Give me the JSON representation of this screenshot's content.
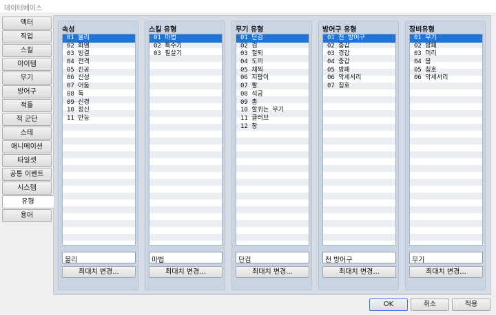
{
  "window": {
    "title": "데이터베이스"
  },
  "sidebar": {
    "items": [
      {
        "label": "액터"
      },
      {
        "label": "직업"
      },
      {
        "label": "스킬"
      },
      {
        "label": "아이템"
      },
      {
        "label": "무기"
      },
      {
        "label": "방어구"
      },
      {
        "label": "적들"
      },
      {
        "label": "적 군단"
      },
      {
        "label": "스테"
      },
      {
        "label": "애니메이션"
      },
      {
        "label": "타일셋"
      },
      {
        "label": "공통 이벤트"
      },
      {
        "label": "시스템"
      },
      {
        "label": "유형",
        "active": true
      },
      {
        "label": "용어"
      }
    ]
  },
  "groups": [
    {
      "label": "속성",
      "items": [
        "01 물리",
        "02 화염",
        "03 빙결",
        "04 전격",
        "05 진공",
        "06 신성",
        "07 어둠",
        "08 독",
        "09 신경",
        "10 정신",
        "11 만능"
      ],
      "selected": 0,
      "field_value": "물리",
      "button_label": "최대치 변경..."
    },
    {
      "label": "스킬 유형",
      "items": [
        "01 마법",
        "02 특수기",
        "03 필살기"
      ],
      "selected": 0,
      "field_value": "마법",
      "button_label": "최대치 변경..."
    },
    {
      "label": "무기 유형",
      "items": [
        "01 단검",
        "02 검",
        "03 철퇴",
        "04 도끼",
        "05 채찍",
        "06 지팡이",
        "07 활",
        "08 석궁",
        "09 총",
        "10 할퀴는 무기",
        "11 글러브",
        "12 창"
      ],
      "selected": 0,
      "field_value": "단검",
      "button_label": "최대치 변경..."
    },
    {
      "label": "방어구 유형",
      "items": [
        "01 천 방어구",
        "02 중갑",
        "03 경갑",
        "04 중갑",
        "05 방패",
        "06 악세서리",
        "07 칭호"
      ],
      "selected": 0,
      "field_value": "천 방어구",
      "button_label": "최대치 변경..."
    },
    {
      "label": "장비유형",
      "items": [
        "01 무기",
        "02 방패",
        "03 머리",
        "04 몸",
        "05 칭호",
        "06 악세서리"
      ],
      "selected": 0,
      "field_value": "무기",
      "button_label": "최대치 변경..."
    }
  ],
  "footer": {
    "ok": "OK",
    "cancel": "취소",
    "apply": "적용"
  },
  "colors": {
    "selection": "#1e74d8",
    "panel": "#d6dce5",
    "group": "#cad5e3"
  }
}
